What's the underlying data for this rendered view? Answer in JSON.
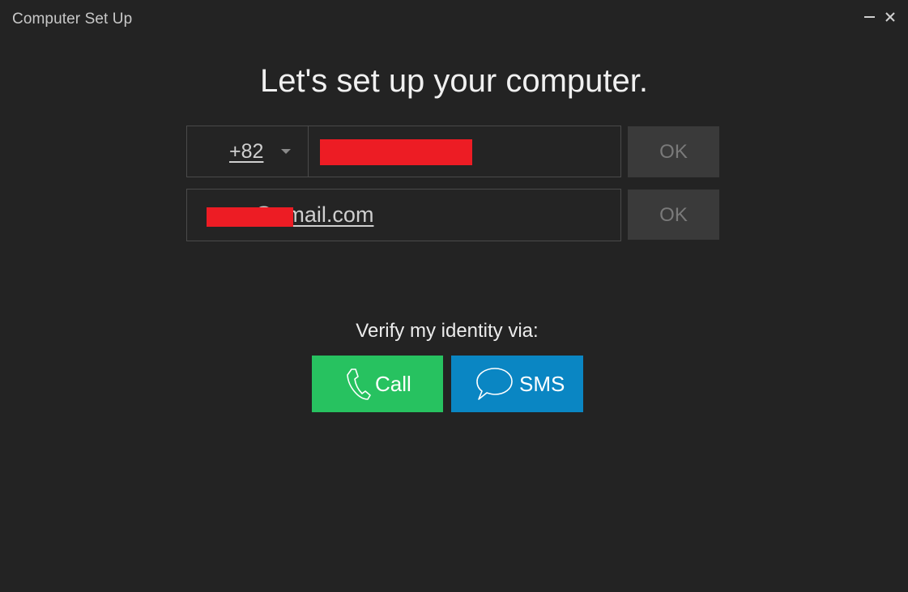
{
  "window": {
    "title": "Computer Set Up",
    "minimize_icon": "minimize-icon",
    "close_icon": "close-icon"
  },
  "main": {
    "heading": "Let's set up your computer.",
    "phone": {
      "country_code": "+82",
      "dropdown_icon": "chevron-down-icon",
      "ok_label": "OK"
    },
    "email": {
      "visible_text": "@gmail.com",
      "ok_label": "OK"
    },
    "verify": {
      "label": "Verify my identity via:",
      "call_label": "Call",
      "sms_label": "SMS",
      "call_icon": "phone-icon",
      "sms_icon": "chat-bubble-icon"
    }
  },
  "colors": {
    "background": "#232323",
    "call_button": "#27c260",
    "sms_button": "#0a86c3",
    "ok_button": "#3a3a3a",
    "redaction": "#ed1c24"
  }
}
